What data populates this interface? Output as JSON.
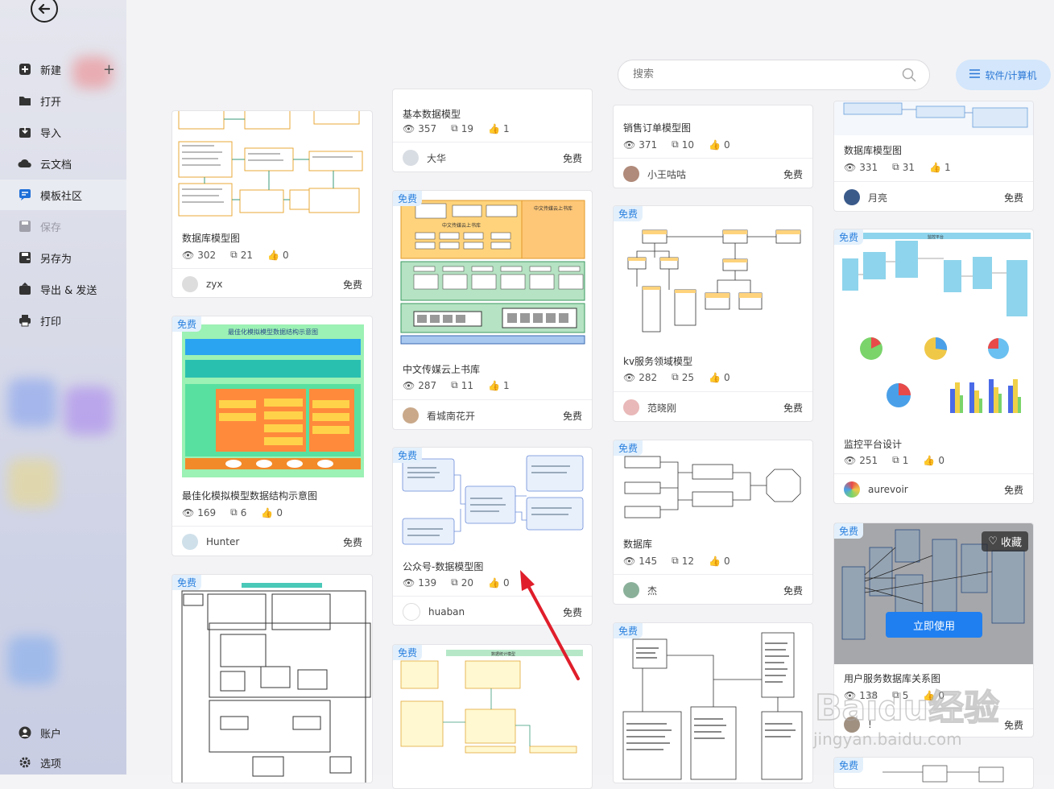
{
  "sidebar": {
    "items": [
      {
        "label": "新建",
        "icon": "plus-square-icon"
      },
      {
        "label": "打开",
        "icon": "folder-icon"
      },
      {
        "label": "导入",
        "icon": "import-icon"
      },
      {
        "label": "云文档",
        "icon": "cloud-icon"
      },
      {
        "label": "模板社区",
        "icon": "community-icon"
      },
      {
        "label": "保存",
        "icon": "save-icon"
      },
      {
        "label": "另存为",
        "icon": "save-as-icon"
      },
      {
        "label": "导出 & 发送",
        "icon": "export-icon"
      },
      {
        "label": "打印",
        "icon": "print-icon"
      }
    ],
    "bottom": [
      {
        "label": "账户",
        "icon": "account-icon"
      },
      {
        "label": "选项",
        "icon": "settings-icon"
      }
    ]
  },
  "search": {
    "placeholder": "搜索"
  },
  "category": {
    "label": "软件/计算机"
  },
  "cards": [
    {
      "title": "数据库模型图",
      "views": "302",
      "copies": "21",
      "likes": "0",
      "author": "zyx",
      "price": "免费"
    },
    {
      "title": "最佳化模拟模型数据结构示意图",
      "badge": "免费",
      "views": "169",
      "copies": "6",
      "likes": "0",
      "author": "Hunter",
      "price": "免费"
    },
    {
      "badge": "免费"
    },
    {
      "title": "基本数据模型",
      "views": "357",
      "copies": "19",
      "likes": "1",
      "author": "大华",
      "price": "免费"
    },
    {
      "title": "中文传媒云上书库",
      "badge": "免费",
      "views": "287",
      "copies": "11",
      "likes": "1",
      "author": "看城南花开",
      "price": "免费"
    },
    {
      "title": "公众号-数据模型图",
      "badge": "免费",
      "views": "139",
      "copies": "20",
      "likes": "0",
      "author": "huaban",
      "price": "免费"
    },
    {
      "badge": "免费"
    },
    {
      "title": "销售订单模型图",
      "views": "371",
      "copies": "10",
      "likes": "0",
      "author": "小王咕咕",
      "price": "免费"
    },
    {
      "title": "kv服务领域模型",
      "badge": "免费",
      "views": "282",
      "copies": "25",
      "likes": "0",
      "author": "范晓刚",
      "price": "免费"
    },
    {
      "title": "数据库",
      "badge": "免费",
      "views": "145",
      "copies": "12",
      "likes": "0",
      "author": "杰",
      "price": "免费"
    },
    {
      "badge": "免费"
    },
    {
      "title": "数据库模型图",
      "views": "331",
      "copies": "31",
      "likes": "1",
      "author": "月亮",
      "price": "免费"
    },
    {
      "title": "监控平台设计",
      "badge": "免费",
      "views": "251",
      "copies": "1",
      "likes": "0",
      "author": "aurevoir",
      "price": "免费"
    },
    {
      "title": "用户服务数据库关系图",
      "badge": "免费",
      "views": "138",
      "copies": "5",
      "likes": "0",
      "author": "!",
      "price": "免费",
      "fav": "收藏",
      "use": "立即使用"
    },
    {
      "badge": "免费"
    }
  ],
  "diagram_text": {
    "opt_title": "最佳化模拟模型数据结构示意图",
    "book_side": "中文传媒云上书库",
    "book_center": "中文传媒云上书库",
    "sales_top": "数据统计模型",
    "monitor_top": "监控平台"
  },
  "watermark": {
    "text": "Baidu经验",
    "url": "jingyan.baidu.com"
  },
  "colors": {
    "accent": "#1f7ff0",
    "badge_bg": "#e3f0fc",
    "badge_fg": "#2a80de",
    "arrow": "#e01e2b"
  }
}
